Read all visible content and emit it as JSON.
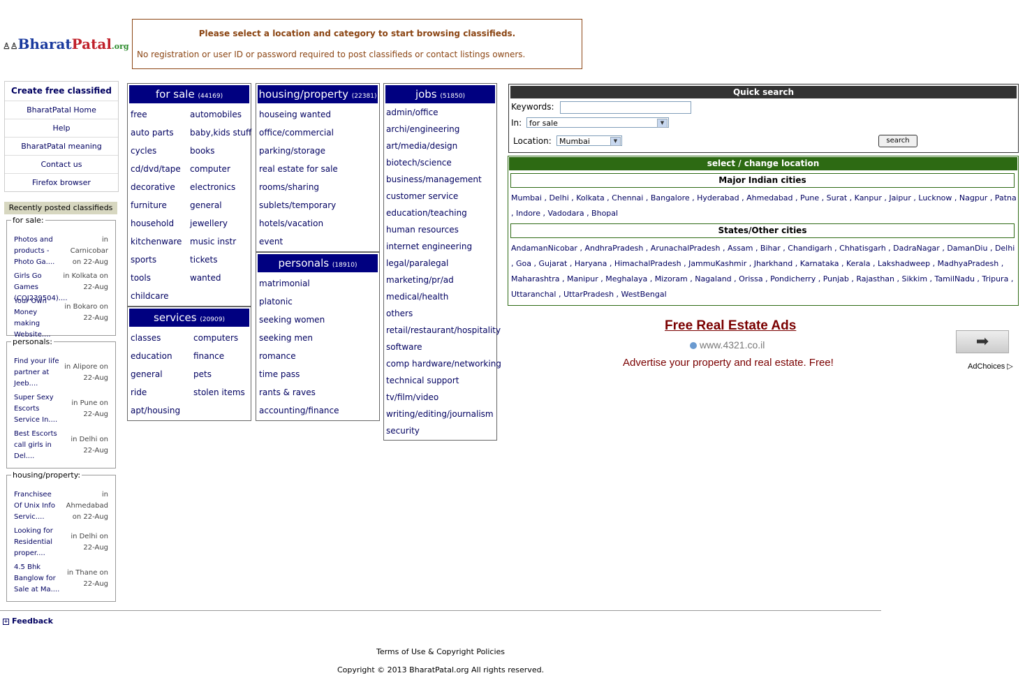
{
  "logo": {
    "part1": "Bharat",
    "part2": "Patal",
    "part3": ".org"
  },
  "notice": {
    "line1": "Please select a location and category to start browsing classifieds.",
    "line2": "No registration or user ID or password required to post classifieds or contact listings owners."
  },
  "leftnav": [
    "Create free classified",
    "BharatPatal Home",
    "Help",
    "BharatPatal meaning",
    "Contact us",
    "Firefox browser"
  ],
  "recent": {
    "heading": "Recently posted classifieds",
    "sections": [
      {
        "legend": "for sale:",
        "items": [
          {
            "title": "Photos and products - Photo Ga....",
            "where": "in Carnicobar on 22-Aug"
          },
          {
            "title": "Girls Go Games (COJ239504)....",
            "where": "in Kolkata on 22-Aug"
          },
          {
            "title": "Your Own Money making Website....",
            "where": "in Bokaro on 22-Aug"
          }
        ]
      },
      {
        "legend": "personals:",
        "items": [
          {
            "title": "Find your life partner at Jeeb....",
            "where": "in Alipore on 22-Aug"
          },
          {
            "title": "Super Sexy Escorts Service In....",
            "where": "in Pune on 22-Aug"
          },
          {
            "title": "Best Escorts call girls in Del....",
            "where": "in Delhi on 22-Aug"
          }
        ]
      },
      {
        "legend": "housing/property:",
        "items": [
          {
            "title": "Franchisee Of Unix Info Servic....",
            "where": "in Ahmedabad on 22-Aug"
          },
          {
            "title": "Looking for Residential proper....",
            "where": "in Delhi on 22-Aug"
          },
          {
            "title": "4.5 Bhk Banglow for Sale at Ma....",
            "where": "in Thane on 22-Aug"
          }
        ]
      }
    ]
  },
  "categories": {
    "forsale": {
      "title": "for sale",
      "count": "(44169)",
      "links": [
        "free",
        "automobiles",
        "auto parts",
        "baby,kids stuff",
        "cycles",
        "books",
        "cd/dvd/tape",
        "computer",
        "decorative",
        "electronics",
        "furniture",
        "general",
        "household",
        "jewellery",
        "kitchenware",
        "music instr",
        "sports",
        "tickets",
        "tools",
        "wanted",
        "childcare"
      ]
    },
    "services": {
      "title": "services",
      "count": "(20909)",
      "links": [
        "classes",
        "computers",
        "education",
        "finance",
        "general",
        "pets",
        "ride",
        "stolen items",
        "apt/housing"
      ]
    },
    "housing": {
      "title": "housing/property",
      "count": "(22381)",
      "links": [
        "houseing wanted",
        "office/commercial",
        "parking/storage",
        "real estate for sale",
        "rooms/sharing",
        "sublets/temporary",
        "hotels/vacation",
        "event"
      ]
    },
    "personals": {
      "title": "personals",
      "count": "(18910)",
      "links": [
        "matrimonial",
        "platonic",
        "seeking women",
        "seeking men",
        "romance",
        "time pass",
        "rants & raves",
        "accounting/finance"
      ]
    },
    "jobs": {
      "title": "jobs",
      "count": "(51850)",
      "links": [
        "admin/office",
        "archi/engineering",
        "art/media/design",
        "biotech/science",
        "business/management",
        "customer service",
        "education/teaching",
        "human resources",
        "internet engineering",
        "legal/paralegal",
        "marketing/pr/ad",
        "medical/health",
        "others",
        "retail/restaurant/hospitality",
        "software",
        "comp hardware/networking",
        "technical support",
        "tv/film/video",
        "writing/editing/journalism",
        "security"
      ]
    }
  },
  "quicksearch": {
    "title": "Quick search",
    "keywords_label": "Keywords:",
    "keywords_value": "",
    "in_label": "In:",
    "in_value": "for sale",
    "location_label": "Location:",
    "location_value": "Mumbai",
    "button": "search"
  },
  "location": {
    "title": "select / change location",
    "major_title": "Major Indian cities",
    "major": "Mumbai , Delhi , Kolkata , Chennai , Bangalore , Hyderabad , Ahmedabad , Pune , Surat , Kanpur , Jaipur , Lucknow , Nagpur , Patna , Indore , Vadodara , Bhopal",
    "states_title": "States/Other cities",
    "states": "AndamanNicobar , AndhraPradesh , ArunachalPradesh , Assam , Bihar , Chandigarh , Chhatisgarh , DadraNagar , DamanDiu , Delhi , Goa , Gujarat , Haryana , HimachalPradesh , JammuKashmir , Jharkhand , Karnataka , Kerala , Lakshadweep , MadhyaPradesh , Maharashtra , Manipur , Meghalaya , Mizoram , Nagaland , Orissa , Pondicherry , Punjab , Rajasthan , Sikkim , TamilNadu , Tripura , Uttaranchal , UttarPradesh , WestBengal"
  },
  "ad": {
    "title": "Free Real Estate Ads",
    "url": "www.4321.co.il",
    "text": "Advertise your property and real estate. Free!",
    "choices": "AdChoices"
  },
  "footer": {
    "feedback": "Feedback",
    "terms": "Terms of Use & Copyright Policies",
    "copyright": "Copyright © 2013 BharatPatal.org All rights reserved."
  }
}
